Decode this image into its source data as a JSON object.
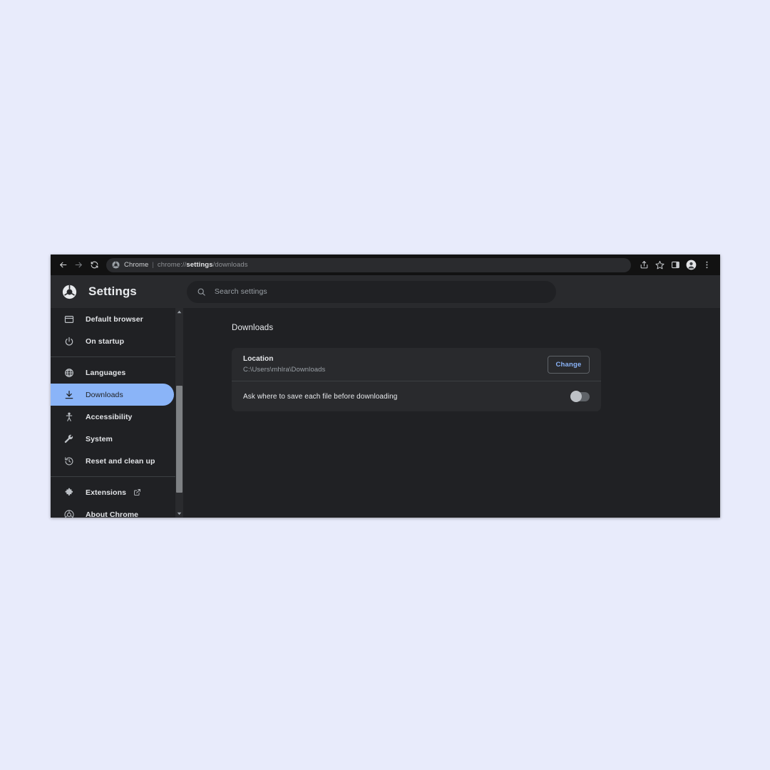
{
  "browser": {
    "toolbar": {
      "back_icon": "back-arrow-icon",
      "forward_icon": "forward-arrow-icon",
      "reload_icon": "reload-icon",
      "omnibox": {
        "chrome_icon": "chrome-logo-icon",
        "label": "Chrome",
        "separator": "|",
        "url_prefix": "chrome://",
        "url_bold": "settings",
        "url_suffix": "/downloads"
      },
      "actions": [
        {
          "name": "share-icon",
          "label": "Share"
        },
        {
          "name": "bookmark-star-icon",
          "label": "Bookmark this tab"
        },
        {
          "name": "side-panel-icon",
          "label": "Side panel"
        },
        {
          "name": "profile-avatar-icon",
          "label": "Profile"
        },
        {
          "name": "more-menu-icon",
          "label": "Customize and control Google Chrome"
        }
      ]
    }
  },
  "settings": {
    "logo": "chrome-logo-icon",
    "title": "Settings",
    "search": {
      "icon": "search-icon",
      "placeholder": "Search settings",
      "value": ""
    },
    "sidebar": {
      "items": [
        {
          "label": "Default browser",
          "icon": "browser-window-icon",
          "selected": false
        },
        {
          "label": "On startup",
          "icon": "power-icon",
          "selected": false
        },
        {
          "label": "Languages",
          "icon": "globe-icon",
          "selected": false
        },
        {
          "label": "Downloads",
          "icon": "download-icon",
          "selected": true
        },
        {
          "label": "Accessibility",
          "icon": "accessibility-icon",
          "selected": false
        },
        {
          "label": "System",
          "icon": "wrench-icon",
          "selected": false
        },
        {
          "label": "Reset and clean up",
          "icon": "history-restore-icon",
          "selected": false
        },
        {
          "label": "Extensions",
          "icon": "puzzle-piece-icon",
          "selected": false,
          "external": true
        },
        {
          "label": "About Chrome",
          "icon": "chrome-logo-icon",
          "selected": false
        }
      ],
      "scrollbar": {
        "up_arrow": "scroll-up-arrow-icon",
        "down_arrow": "scroll-down-arrow-icon"
      }
    },
    "main": {
      "heading": "Downloads",
      "location": {
        "label": "Location",
        "path": "C:\\Users\\mhlra\\Downloads",
        "change_button": "Change"
      },
      "ask_where_to_save": {
        "label": "Ask where to save each file before downloading",
        "enabled": false
      }
    }
  },
  "colors": {
    "page_background": "#e8ebfb",
    "window_background": "#202124",
    "header_background": "#292a2d",
    "toolbar_background": "#121212",
    "accent_blue": "#8ab4f8",
    "card_background": "#292a2d",
    "divider": "#3c4043",
    "text_primary": "#e8eaed",
    "text_secondary": "#9aa0a6"
  }
}
